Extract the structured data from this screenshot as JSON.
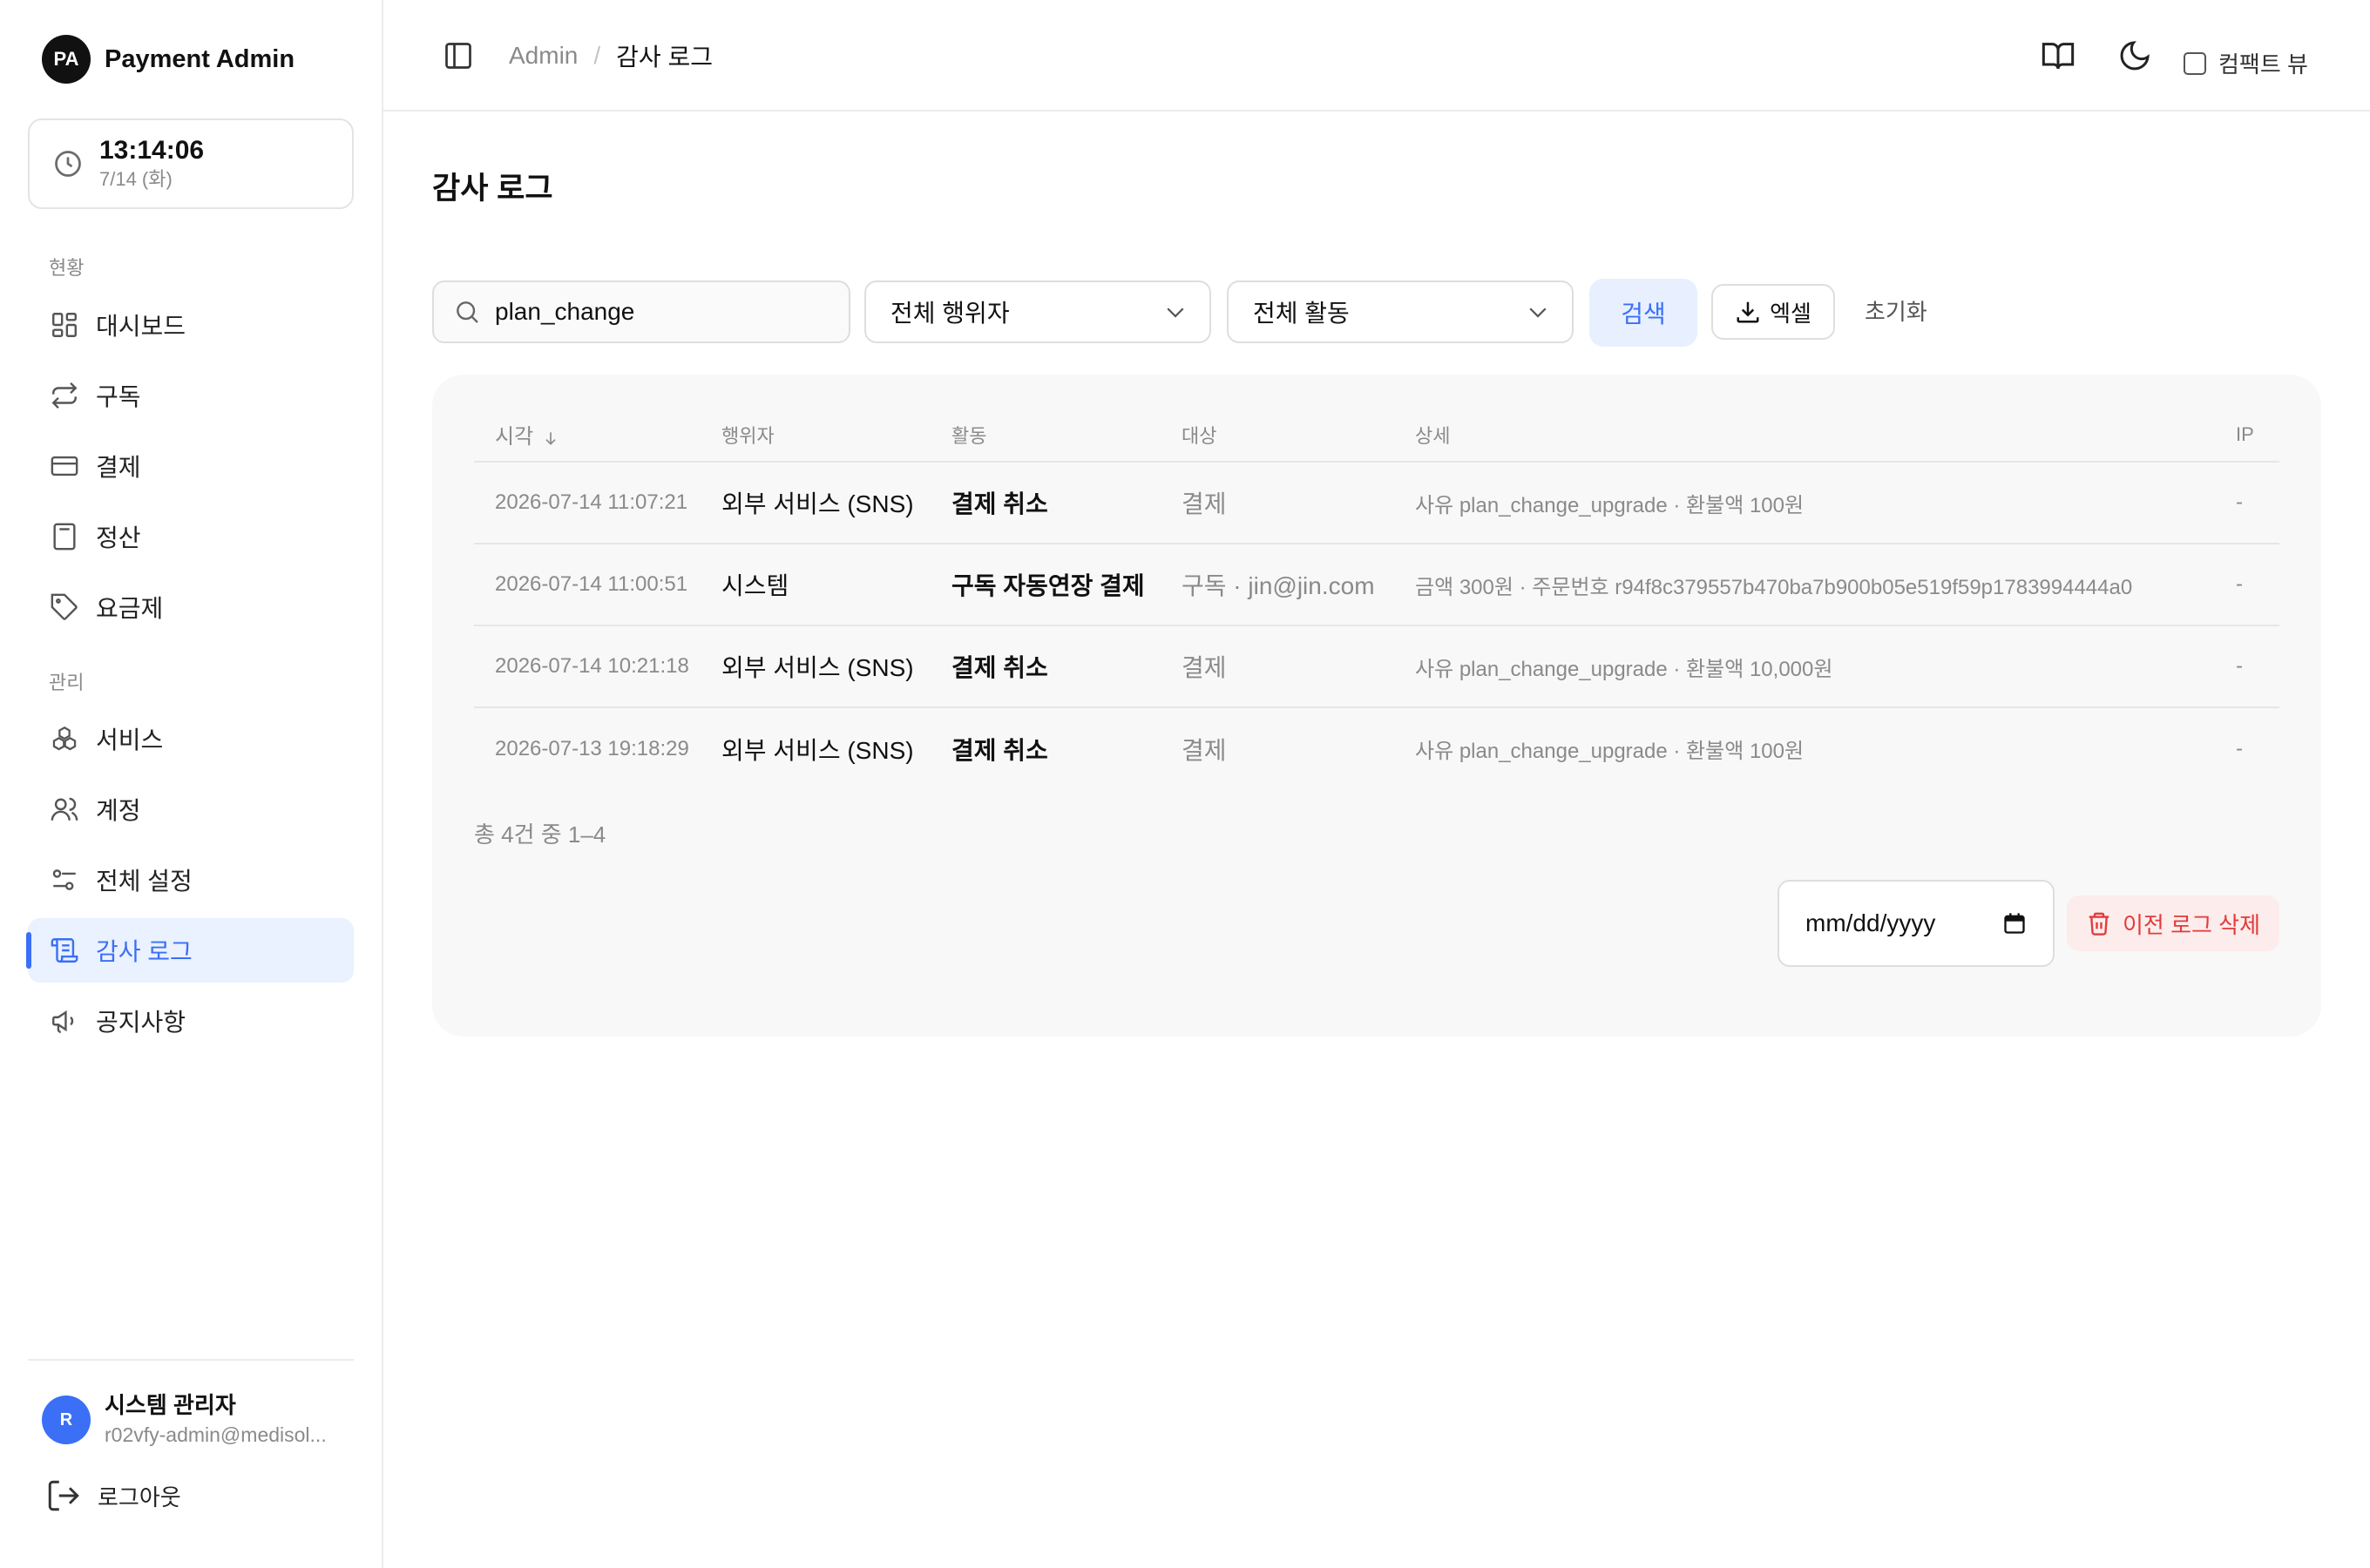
{
  "brand": {
    "logo": "PA",
    "name": "Payment Admin"
  },
  "clock": {
    "time": "13:14:06",
    "date": "7/14 (화)",
    "icon": "clock-icon"
  },
  "sidebar": {
    "section_status": "현황",
    "section_manage": "관리",
    "items": [
      {
        "label": "대시보드",
        "icon": "grid-icon"
      },
      {
        "label": "구독",
        "icon": "repeat-icon"
      },
      {
        "label": "결제",
        "icon": "credit-card-icon"
      },
      {
        "label": "정산",
        "icon": "calculator-icon"
      },
      {
        "label": "요금제",
        "icon": "tag-icon"
      },
      {
        "label": "서비스",
        "icon": "boxes-icon"
      },
      {
        "label": "계정",
        "icon": "users-icon"
      },
      {
        "label": "전체 설정",
        "icon": "sliders-icon"
      },
      {
        "label": "감사 로그",
        "icon": "scroll-icon",
        "active": true
      },
      {
        "label": "공지사항",
        "icon": "megaphone-icon"
      }
    ]
  },
  "user": {
    "initial": "R",
    "name": "시스템 관리자",
    "email": "r02vfy-admin@medisol..."
  },
  "logout": {
    "label": "로그아웃"
  },
  "header": {
    "breadcrumb_root": "Admin",
    "breadcrumb_sep": "/",
    "breadcrumb_current": "감사 로그",
    "compact_label": "컴팩트 뷰"
  },
  "page": {
    "title": "감사 로그"
  },
  "filters": {
    "search_value": "plan_change",
    "actor_select": "전체 행위자",
    "activity_select": "전체 활동",
    "search_button": "검색",
    "excel_button": "엑셀",
    "reset_button": "초기화"
  },
  "table": {
    "headers": {
      "time": "시각",
      "actor": "행위자",
      "activity": "활동",
      "target": "대상",
      "detail": "상세",
      "ip": "IP"
    },
    "rows": [
      {
        "time": "2026-07-14 11:07:21",
        "actor": "외부 서비스 (SNS)",
        "activity": "결제 취소",
        "target": "결제",
        "detail": "사유 plan_change_upgrade · 환불액 100원",
        "ip": "-"
      },
      {
        "time": "2026-07-14 11:00:51",
        "actor": "시스템",
        "activity": "구독 자동연장 결제",
        "target": "구독 · jin@jin.com",
        "detail": "금액 300원 · 주문번호 r94f8c379557b470ba7b900b05e519f59p1783994444a0",
        "ip": "-"
      },
      {
        "time": "2026-07-14 10:21:18",
        "actor": "외부 서비스 (SNS)",
        "activity": "결제 취소",
        "target": "결제",
        "detail": "사유 plan_change_upgrade · 환불액 10,000원",
        "ip": "-"
      },
      {
        "time": "2026-07-13 19:18:29",
        "actor": "외부 서비스 (SNS)",
        "activity": "결제 취소",
        "target": "결제",
        "detail": "사유 plan_change_upgrade · 환불액 100원",
        "ip": "-"
      }
    ]
  },
  "pagination": {
    "summary": "총 4건 중 1–4"
  },
  "purge": {
    "date_placeholder": "mm/dd/yyyy",
    "delete_button": "이전 로그 삭제"
  },
  "colors": {
    "accent": "#3b6ff5",
    "danger": "#e23b3b",
    "accent_bg": "#e8f0ff",
    "danger_bg": "#fdecec"
  }
}
